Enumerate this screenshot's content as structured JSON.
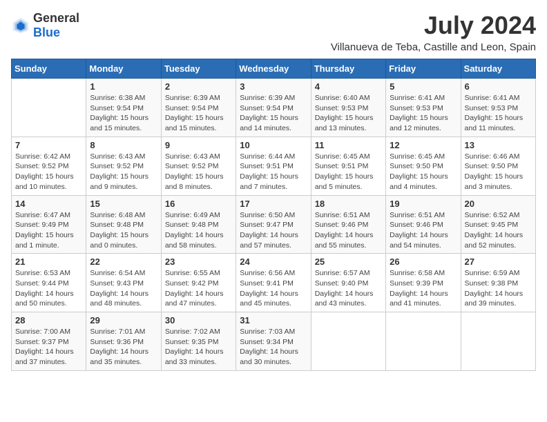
{
  "logo": {
    "general": "General",
    "blue": "Blue"
  },
  "title": "July 2024",
  "subtitle": "Villanueva de Teba, Castille and Leon, Spain",
  "headers": [
    "Sunday",
    "Monday",
    "Tuesday",
    "Wednesday",
    "Thursday",
    "Friday",
    "Saturday"
  ],
  "weeks": [
    [
      {
        "day": "",
        "info": ""
      },
      {
        "day": "1",
        "info": "Sunrise: 6:38 AM\nSunset: 9:54 PM\nDaylight: 15 hours and 15 minutes."
      },
      {
        "day": "2",
        "info": "Sunrise: 6:39 AM\nSunset: 9:54 PM\nDaylight: 15 hours and 15 minutes."
      },
      {
        "day": "3",
        "info": "Sunrise: 6:39 AM\nSunset: 9:54 PM\nDaylight: 15 hours and 14 minutes."
      },
      {
        "day": "4",
        "info": "Sunrise: 6:40 AM\nSunset: 9:53 PM\nDaylight: 15 hours and 13 minutes."
      },
      {
        "day": "5",
        "info": "Sunrise: 6:41 AM\nSunset: 9:53 PM\nDaylight: 15 hours and 12 minutes."
      },
      {
        "day": "6",
        "info": "Sunrise: 6:41 AM\nSunset: 9:53 PM\nDaylight: 15 hours and 11 minutes."
      }
    ],
    [
      {
        "day": "7",
        "info": "Sunrise: 6:42 AM\nSunset: 9:52 PM\nDaylight: 15 hours and 10 minutes."
      },
      {
        "day": "8",
        "info": "Sunrise: 6:43 AM\nSunset: 9:52 PM\nDaylight: 15 hours and 9 minutes."
      },
      {
        "day": "9",
        "info": "Sunrise: 6:43 AM\nSunset: 9:52 PM\nDaylight: 15 hours and 8 minutes."
      },
      {
        "day": "10",
        "info": "Sunrise: 6:44 AM\nSunset: 9:51 PM\nDaylight: 15 hours and 7 minutes."
      },
      {
        "day": "11",
        "info": "Sunrise: 6:45 AM\nSunset: 9:51 PM\nDaylight: 15 hours and 5 minutes."
      },
      {
        "day": "12",
        "info": "Sunrise: 6:45 AM\nSunset: 9:50 PM\nDaylight: 15 hours and 4 minutes."
      },
      {
        "day": "13",
        "info": "Sunrise: 6:46 AM\nSunset: 9:50 PM\nDaylight: 15 hours and 3 minutes."
      }
    ],
    [
      {
        "day": "14",
        "info": "Sunrise: 6:47 AM\nSunset: 9:49 PM\nDaylight: 15 hours and 1 minute."
      },
      {
        "day": "15",
        "info": "Sunrise: 6:48 AM\nSunset: 9:48 PM\nDaylight: 15 hours and 0 minutes."
      },
      {
        "day": "16",
        "info": "Sunrise: 6:49 AM\nSunset: 9:48 PM\nDaylight: 14 hours and 58 minutes."
      },
      {
        "day": "17",
        "info": "Sunrise: 6:50 AM\nSunset: 9:47 PM\nDaylight: 14 hours and 57 minutes."
      },
      {
        "day": "18",
        "info": "Sunrise: 6:51 AM\nSunset: 9:46 PM\nDaylight: 14 hours and 55 minutes."
      },
      {
        "day": "19",
        "info": "Sunrise: 6:51 AM\nSunset: 9:46 PM\nDaylight: 14 hours and 54 minutes."
      },
      {
        "day": "20",
        "info": "Sunrise: 6:52 AM\nSunset: 9:45 PM\nDaylight: 14 hours and 52 minutes."
      }
    ],
    [
      {
        "day": "21",
        "info": "Sunrise: 6:53 AM\nSunset: 9:44 PM\nDaylight: 14 hours and 50 minutes."
      },
      {
        "day": "22",
        "info": "Sunrise: 6:54 AM\nSunset: 9:43 PM\nDaylight: 14 hours and 48 minutes."
      },
      {
        "day": "23",
        "info": "Sunrise: 6:55 AM\nSunset: 9:42 PM\nDaylight: 14 hours and 47 minutes."
      },
      {
        "day": "24",
        "info": "Sunrise: 6:56 AM\nSunset: 9:41 PM\nDaylight: 14 hours and 45 minutes."
      },
      {
        "day": "25",
        "info": "Sunrise: 6:57 AM\nSunset: 9:40 PM\nDaylight: 14 hours and 43 minutes."
      },
      {
        "day": "26",
        "info": "Sunrise: 6:58 AM\nSunset: 9:39 PM\nDaylight: 14 hours and 41 minutes."
      },
      {
        "day": "27",
        "info": "Sunrise: 6:59 AM\nSunset: 9:38 PM\nDaylight: 14 hours and 39 minutes."
      }
    ],
    [
      {
        "day": "28",
        "info": "Sunrise: 7:00 AM\nSunset: 9:37 PM\nDaylight: 14 hours and 37 minutes."
      },
      {
        "day": "29",
        "info": "Sunrise: 7:01 AM\nSunset: 9:36 PM\nDaylight: 14 hours and 35 minutes."
      },
      {
        "day": "30",
        "info": "Sunrise: 7:02 AM\nSunset: 9:35 PM\nDaylight: 14 hours and 33 minutes."
      },
      {
        "day": "31",
        "info": "Sunrise: 7:03 AM\nSunset: 9:34 PM\nDaylight: 14 hours and 30 minutes."
      },
      {
        "day": "",
        "info": ""
      },
      {
        "day": "",
        "info": ""
      },
      {
        "day": "",
        "info": ""
      }
    ]
  ]
}
